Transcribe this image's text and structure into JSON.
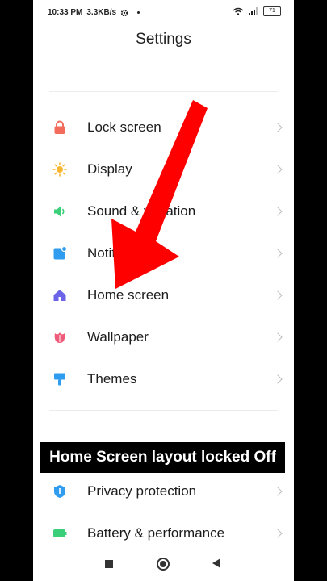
{
  "status_bar": {
    "time": "10:33 PM",
    "speed": "3.3KB/s",
    "battery": "71"
  },
  "header": {
    "title": "Settings"
  },
  "settings_items": [
    {
      "label": "Lock screen",
      "icon": "lock-icon",
      "color": "#f26b5b"
    },
    {
      "label": "Display",
      "icon": "sun-icon",
      "color": "#f7b733"
    },
    {
      "label": "Sound & vibration",
      "icon": "speaker-icon",
      "color": "#3ccf7a"
    },
    {
      "label": "Notifications",
      "icon": "notification-icon",
      "color": "#2f9cf0"
    },
    {
      "label": "Home screen",
      "icon": "home-icon",
      "color": "#6b63e8"
    },
    {
      "label": "Wallpaper",
      "icon": "tulip-icon",
      "color": "#ee5b7a"
    },
    {
      "label": "Themes",
      "icon": "paintbrush-icon",
      "color": "#2f9cf0"
    }
  ],
  "settings_items_2": [
    {
      "label": "Privacy protection",
      "icon": "shield-icon",
      "color": "#2f9cf0"
    },
    {
      "label": "Battery & performance",
      "icon": "battery-icon",
      "color": "#3ccf7a"
    }
  ],
  "caption": "Home Screen layout locked Off",
  "colors": {
    "arrow": "#ff0000"
  }
}
